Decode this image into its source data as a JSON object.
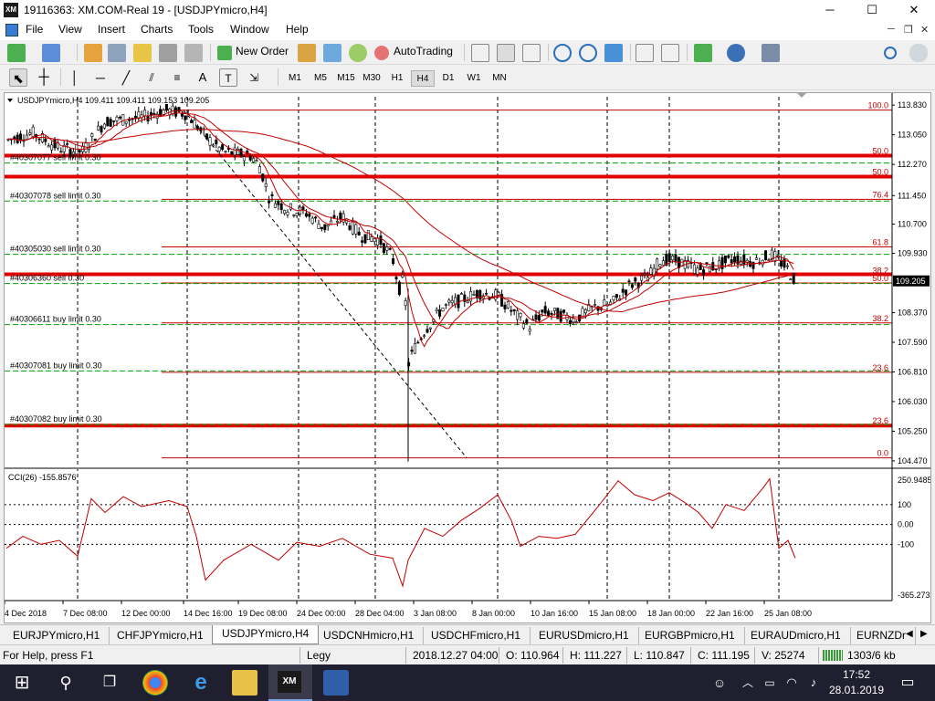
{
  "window": {
    "title": "19116363: XM.COM-Real 19 - [USDJPYmicro,H4]",
    "app_logo": "XM",
    "controls": [
      "minimize-icon",
      "maximize-icon",
      "close-icon"
    ]
  },
  "menu": {
    "items": [
      "File",
      "View",
      "Insert",
      "Charts",
      "Tools",
      "Window",
      "Help"
    ]
  },
  "toolbar": {
    "new_order_label": "New Order",
    "autotrading_label": "AutoTrading"
  },
  "timeframes": {
    "items": [
      "M1",
      "M5",
      "M15",
      "M30",
      "H1",
      "H4",
      "D1",
      "W1",
      "MN"
    ],
    "active": "H4"
  },
  "chart": {
    "header": "USDJPYmicro,H4  109.411 109.411 109.153 109.205",
    "current_price": "109.205",
    "price_ticks": [
      "113.830",
      "113.050",
      "112.270",
      "111.450",
      "110.700",
      "109.930",
      "109.205",
      "108.370",
      "107.590",
      "106.810",
      "106.030",
      "105.250",
      "104.470"
    ],
    "time_ticks": [
      "4 Dec 2018",
      "7 Dec 08:00",
      "12 Dec 00:00",
      "14 Dec 16:00",
      "19 Dec 08:00",
      "24 Dec 00:00",
      "28 Dec 04:00",
      "3 Jan 08:00",
      "8 Jan 00:00",
      "10 Jan 16:00",
      "15 Jan 08:00",
      "18 Jan 00:00",
      "22 Jan 16:00",
      "25 Jan 08:00"
    ],
    "order_labels": [
      {
        "text": "#40307077 sell limit 0.30",
        "price": 112.45
      },
      {
        "text": "#40307078 sell limit 0.30",
        "price": 111.45
      },
      {
        "text": "#40305030 sell limit 0.30",
        "price": 110.05
      },
      {
        "text": "#40306360 sell 0.30",
        "price": 109.28
      },
      {
        "text": "#40306611 buy limit 0.30",
        "price": 108.2
      },
      {
        "text": "#40307081 buy limit 0.30",
        "price": 106.98
      },
      {
        "text": "#40307082 buy limit 0.30",
        "price": 105.57
      }
    ],
    "fib_levels": [
      {
        "label": "100.0",
        "price": 113.7
      },
      {
        "label": "50.0",
        "price": 112.5
      },
      {
        "label": "50.0",
        "price": 111.95
      },
      {
        "label": "76.4",
        "price": 111.35
      },
      {
        "label": "61.8",
        "price": 110.1
      },
      {
        "label": "38.2",
        "price": 109.35
      },
      {
        "label": "50.0",
        "price": 109.15
      },
      {
        "label": "38.2",
        "price": 108.1
      },
      {
        "label": "23.6",
        "price": 106.8
      },
      {
        "label": "23.6",
        "price": 105.4
      },
      {
        "label": "0.0",
        "price": 104.55
      }
    ],
    "thick_red_levels": [
      112.5,
      111.95,
      109.38,
      105.4
    ],
    "indicator": {
      "label": "CCI(26) -155.8576",
      "ticks": [
        "250.9485",
        "100",
        "0.00",
        "-100",
        "-365.2739"
      ]
    },
    "colors": {
      "candles": "#000000",
      "moving_avg": "#c00000",
      "fib": "#c00000",
      "thick_line": "#e00000",
      "order_dash": "#00a000",
      "cci": "#c00000"
    }
  },
  "symbol_tabs": {
    "items": [
      "EURJPYmicro,H1",
      "CHFJPYmicro,H1",
      "USDJPYmicro,H4",
      "USDCNHmicro,H1",
      "USDCHFmicro,H1",
      "EURUSDmicro,H1",
      "EURGBPmicro,H1",
      "EURAUDmicro,H1",
      "EURNZDr"
    ],
    "active_index": 2
  },
  "status": {
    "help": "For Help, press F1",
    "profile": "Legy",
    "datetime": "2018.12.27 04:00",
    "open": "O: 110.964",
    "high": "H: 111.227",
    "low": "L: 110.847",
    "close": "C: 111.195",
    "volume": "V: 25274",
    "traffic": "1303/6 kb"
  },
  "taskbar": {
    "time": "17:52",
    "date": "28.01.2019"
  }
}
